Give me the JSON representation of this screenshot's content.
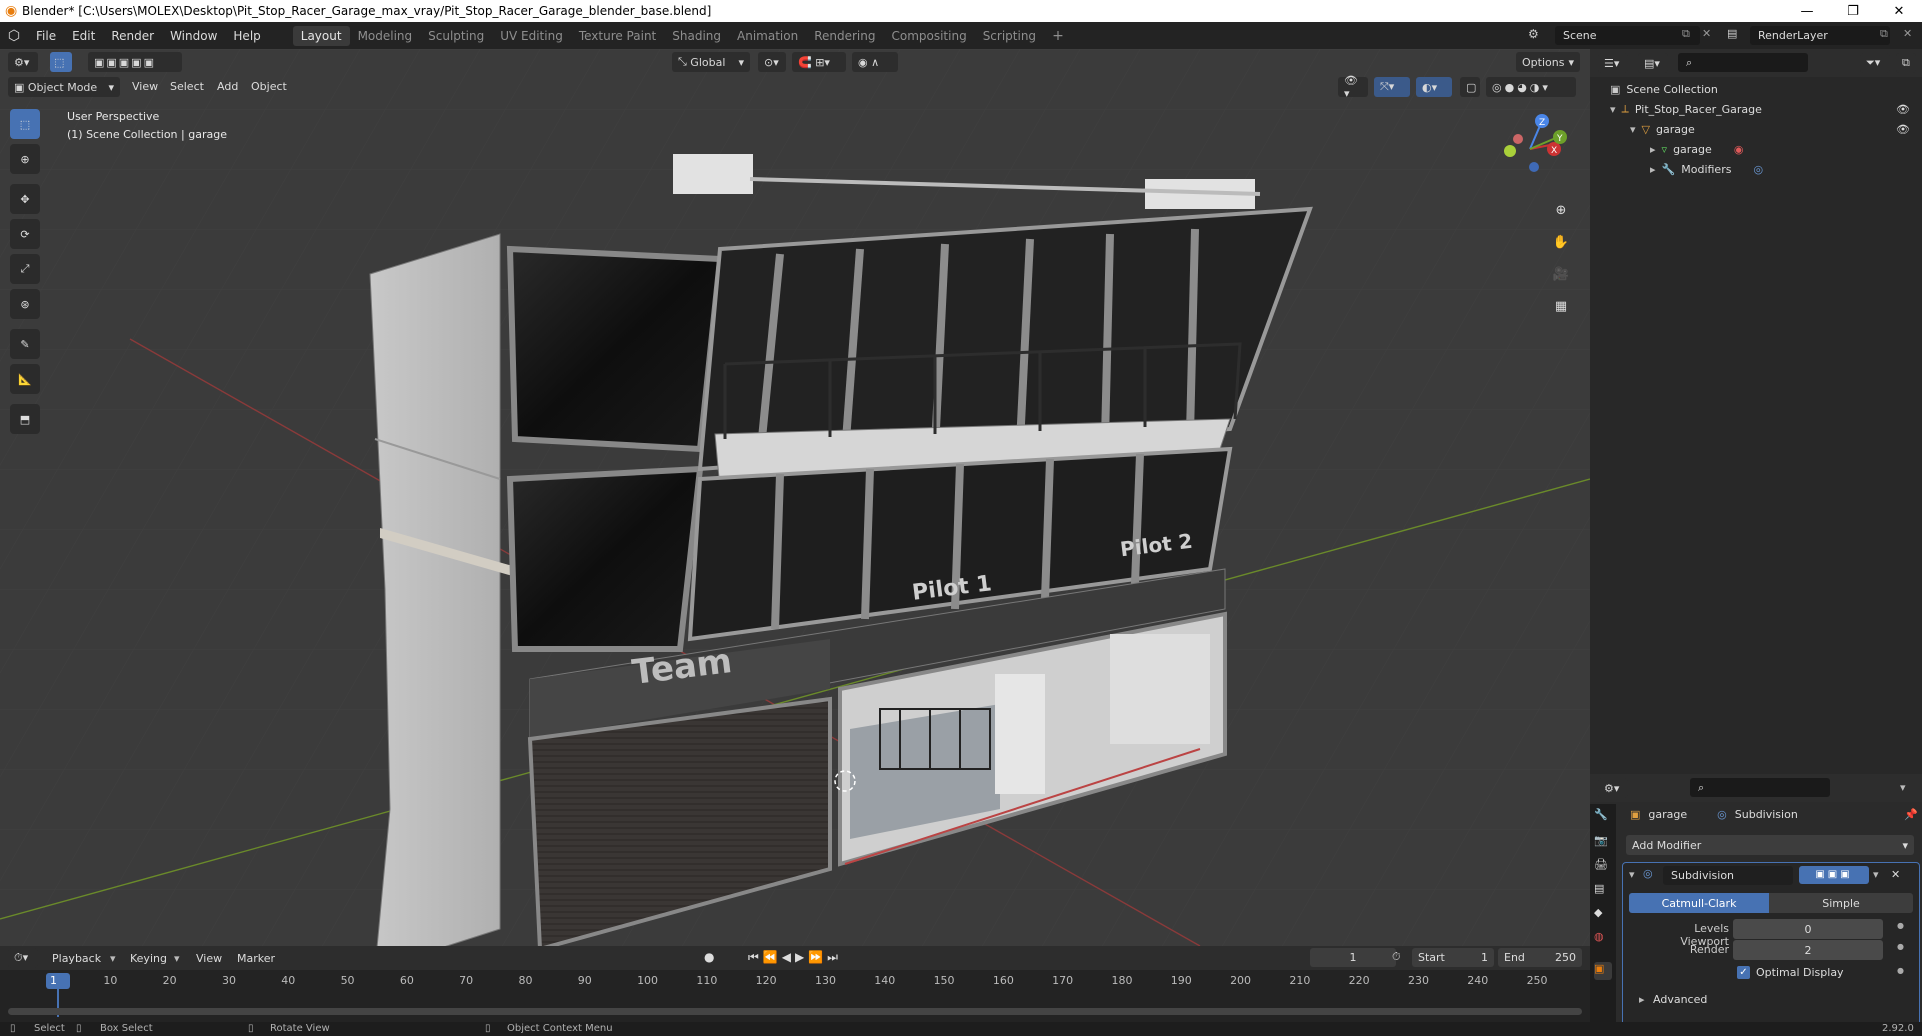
{
  "window": {
    "title": "Blender* [C:\\Users\\MOLEX\\Desktop\\Pit_Stop_Racer_Garage_max_vray/Pit_Stop_Racer_Garage_blender_base.blend]",
    "minimize": "—",
    "maximize": "❐",
    "close": "✕"
  },
  "menu": [
    "File",
    "Edit",
    "Render",
    "Window",
    "Help"
  ],
  "workspaces": [
    "Layout",
    "Modeling",
    "Sculpting",
    "UV Editing",
    "Texture Paint",
    "Shading",
    "Animation",
    "Rendering",
    "Compositing",
    "Scripting"
  ],
  "active_workspace": "Layout",
  "scene": {
    "name": "Scene",
    "render_layer": "RenderLayer"
  },
  "viewport_header": {
    "mode": "Object Mode",
    "menus": [
      "View",
      "Select",
      "Add",
      "Object"
    ],
    "transform_orientation": "Global",
    "options": "Options"
  },
  "viewport": {
    "info_line1": "User Perspective",
    "info_line2": "(1) Scene Collection | garage",
    "sign_team": "Team",
    "sign_pilot1": "Pilot 1",
    "sign_pilot2": "Pilot 2",
    "gizmo": {
      "x": "X",
      "y": "Y",
      "z": "Z"
    }
  },
  "outliner": {
    "search_placeholder": "",
    "rows": [
      {
        "label": "Scene Collection",
        "icon": "collection-icon"
      },
      {
        "label": "Pit_Stop_Racer_Garage",
        "icon": "empty-icon"
      },
      {
        "label": "garage",
        "icon": "object-icon"
      },
      {
        "label": "garage",
        "icon": "mesh-icon"
      },
      {
        "label": "Modifiers",
        "icon": "wrench-icon"
      }
    ]
  },
  "properties": {
    "object_name": "garage",
    "modifier_context": "Subdivision",
    "add_modifier": "Add Modifier",
    "modifier_name": "Subdivision",
    "tab_catmull": "Catmull-Clark",
    "tab_simple": "Simple",
    "levels_viewport_label": "Levels Viewport",
    "levels_viewport_value": "0",
    "render_label": "Render",
    "render_value": "2",
    "optimal_display": "Optimal Display",
    "advanced": "Advanced"
  },
  "timeline": {
    "menus": [
      "Playback",
      "Keying",
      "View",
      "Marker"
    ],
    "current_frame": "1",
    "start_label": "Start",
    "start_value": "1",
    "end_label": "End",
    "end_value": "250",
    "ticks": [
      "1",
      "10",
      "20",
      "30",
      "40",
      "50",
      "60",
      "70",
      "80",
      "90",
      "100",
      "110",
      "120",
      "130",
      "140",
      "150",
      "160",
      "170",
      "180",
      "190",
      "200",
      "210",
      "220",
      "230",
      "240",
      "250"
    ]
  },
  "statusbar": {
    "select": "Select",
    "box_select": "Box Select",
    "rotate_view": "Rotate View",
    "context_menu": "Object Context Menu",
    "version": "2.92.0"
  },
  "colors": {
    "accent": "#4772b3",
    "bg": "#3b3b3b",
    "panel": "#2b2b2b"
  }
}
